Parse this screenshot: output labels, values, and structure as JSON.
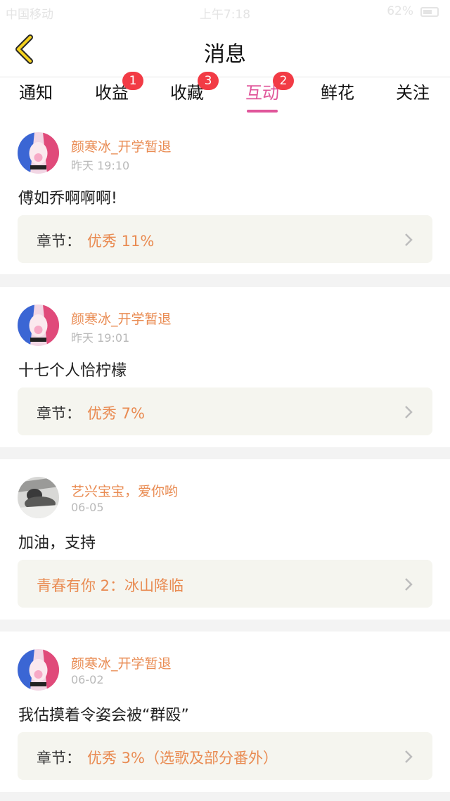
{
  "status_bar": {
    "carrier": "中国移动",
    "time": "上午7:18",
    "battery": "62%"
  },
  "header": {
    "title": "消息"
  },
  "tabs": [
    {
      "label": "通知",
      "badge": "",
      "active": false
    },
    {
      "label": "收益",
      "badge": "1",
      "active": false
    },
    {
      "label": "收藏",
      "badge": "3",
      "active": false
    },
    {
      "label": "互动",
      "badge": "2",
      "active": true
    },
    {
      "label": "鲜花",
      "badge": "",
      "active": false
    },
    {
      "label": "关注",
      "badge": "",
      "active": false
    }
  ],
  "messages": [
    {
      "user": "颜寒冰_开学暂退",
      "time": "昨天 19:10",
      "comment": "傅如乔啊啊啊!",
      "source_prefix": "章节：",
      "source_title": "优秀 11%"
    },
    {
      "user": "颜寒冰_开学暂退",
      "time": "昨天 19:01",
      "comment": "十七个人恰柠檬",
      "source_prefix": "章节：",
      "source_title": "优秀 7%"
    },
    {
      "user": "艺兴宝宝，爱你哟",
      "time": "06-05",
      "comment": "加油，支持",
      "source_prefix": "",
      "source_title": "青春有你 2：冰山降临"
    },
    {
      "user": "颜寒冰_开学暂退",
      "time": "06-02",
      "comment": "我估摸着令姿会被“群殴”",
      "source_prefix": "章节：",
      "source_title": "优秀 3%（选歌及部分番外）"
    }
  ],
  "colors": {
    "accent_pink": "#e0559a",
    "username_orange": "#e98b52",
    "badge_red": "#f23b45"
  },
  "icons": {
    "back": "chevron-left-icon",
    "source": "chevron-right-icon"
  }
}
